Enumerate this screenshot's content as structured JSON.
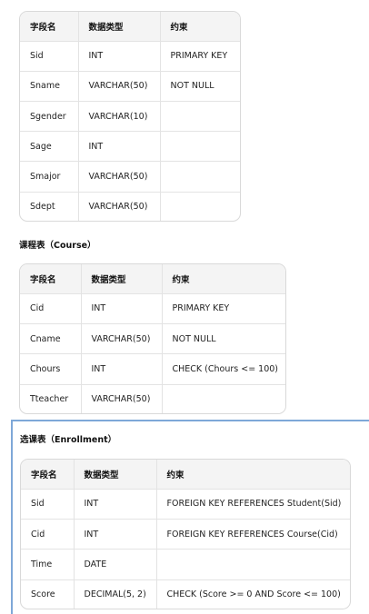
{
  "student": {
    "headers": [
      "字段名",
      "数据类型",
      "约束"
    ],
    "rows": [
      [
        "Sid",
        "INT",
        "PRIMARY KEY"
      ],
      [
        "Sname",
        "VARCHAR(50)",
        "NOT NULL"
      ],
      [
        "Sgender",
        "VARCHAR(10)",
        ""
      ],
      [
        "Sage",
        "INT",
        ""
      ],
      [
        "Smajor",
        "VARCHAR(50)",
        ""
      ],
      [
        "Sdept",
        "VARCHAR(50)",
        ""
      ]
    ]
  },
  "course": {
    "title": "课程表（Course）",
    "headers": [
      "字段名",
      "数据类型",
      "约束"
    ],
    "rows": [
      [
        "Cid",
        "INT",
        "PRIMARY KEY"
      ],
      [
        "Cname",
        "VARCHAR(50)",
        "NOT NULL"
      ],
      [
        "Chours",
        "INT",
        "CHECK (Chours <= 100)"
      ],
      [
        "Tteacher",
        "VARCHAR(50)",
        ""
      ]
    ]
  },
  "enrollment": {
    "title": "选课表（Enrollment）",
    "headers": [
      "字段名",
      "数据类型",
      "约束"
    ],
    "rows": [
      [
        "Sid",
        "INT",
        "FOREIGN KEY REFERENCES Student(Sid)"
      ],
      [
        "Cid",
        "INT",
        "FOREIGN KEY REFERENCES Course(Cid)"
      ],
      [
        "Time",
        "DATE",
        ""
      ],
      [
        "Score",
        "DECIMAL(5, 2)",
        "CHECK (Score >= 0 AND Score <= 100)"
      ]
    ]
  },
  "colors": {
    "header_bg": "#f4f4f4",
    "border": "#d9d9d9",
    "selection": "#7ea8d8"
  }
}
